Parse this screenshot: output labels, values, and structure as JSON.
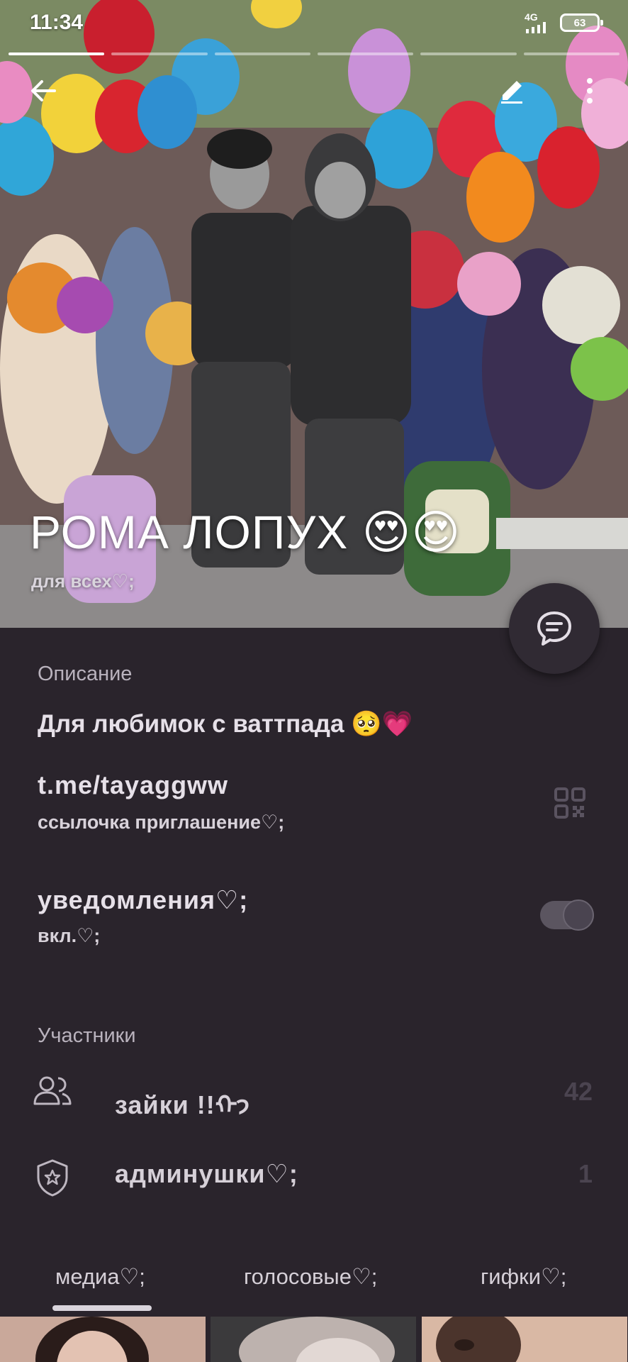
{
  "status_bar": {
    "time": "11:34",
    "network": "4G",
    "battery": "63"
  },
  "header": {
    "title": "РОМА ЛОПУХ 😍😍",
    "subtitle": "для всех♡;"
  },
  "description": {
    "label": "Описание",
    "text": "Для любимок с ваттпада 🥺💗"
  },
  "invite_link": {
    "url": "t.me/tayaggww",
    "caption": "ссылочка приглашение♡;"
  },
  "notifications": {
    "title": "уведомления♡;",
    "state": "вкл.♡;",
    "enabled": true
  },
  "members": {
    "label": "Участники",
    "rows": [
      {
        "name": "зайки !!ᡣ𐭩",
        "count": "42",
        "icon": "people-icon"
      },
      {
        "name": "админушки♡;",
        "count": "1",
        "icon": "shield-star-icon"
      }
    ]
  },
  "tabs": [
    {
      "label": "медиа♡;",
      "active": true
    },
    {
      "label": "голосовые♡;",
      "active": false
    },
    {
      "label": "гифки♡;",
      "active": false
    }
  ],
  "colors": {
    "background": "#2a242c",
    "fab": "#302a33",
    "text_primary": "#e6e0e8",
    "text_muted": "#b9b2bd"
  }
}
